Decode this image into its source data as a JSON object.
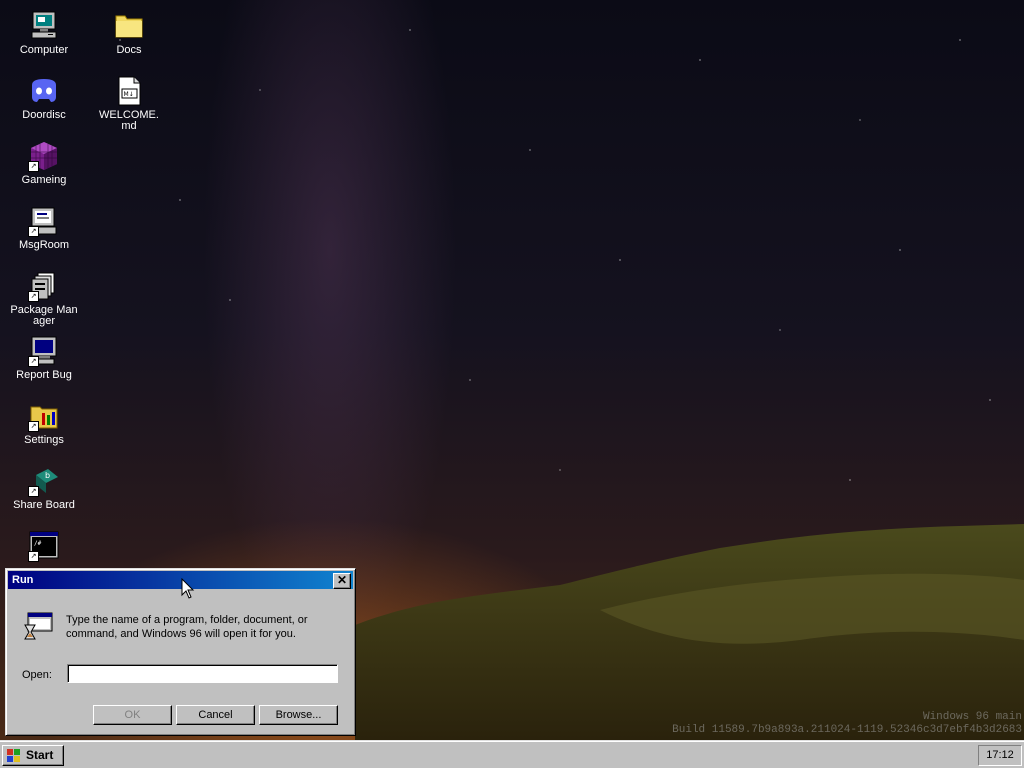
{
  "desktop": {
    "icons": [
      {
        "label": "Computer",
        "icon": "computer-icon",
        "shortcut": false
      },
      {
        "label": "Doordisc",
        "icon": "chat-app-icon",
        "shortcut": false
      },
      {
        "label": "Gameing",
        "icon": "cube-icon",
        "shortcut": true
      },
      {
        "label": "MsgRoom",
        "icon": "message-room-icon",
        "shortcut": true
      },
      {
        "label": "Package Manager",
        "icon": "package-icon",
        "shortcut": true
      },
      {
        "label": "Report Bug",
        "icon": "monitor-icon",
        "shortcut": true
      },
      {
        "label": "Settings",
        "icon": "settings-folder-icon",
        "shortcut": true
      },
      {
        "label": "Share Board",
        "icon": "share-board-icon",
        "shortcut": true
      },
      {
        "label": "",
        "icon": "terminal-icon",
        "shortcut": true
      },
      {
        "label": "Docs",
        "icon": "folder-icon",
        "shortcut": false
      },
      {
        "label": "WELCOME.md",
        "icon": "markdown-file-icon",
        "shortcut": false
      }
    ],
    "watermark": {
      "line1": "Windows 96 main",
      "line2": "Build 11589.7b9a893a.211024-1119.52346c3d7ebf4b3d2683"
    }
  },
  "run_dialog": {
    "title": "Run",
    "close_label": "✕",
    "message": "Type the name of a program, folder, document, or command, and Windows 96 will open it for you.",
    "open_label": "Open:",
    "open_value": "",
    "ok_label": "OK",
    "cancel_label": "Cancel",
    "browse_label": "Browse..."
  },
  "taskbar": {
    "start_label": "Start",
    "clock": "17:12"
  },
  "colors": {
    "titlebar_start": "#000080",
    "titlebar_end": "#1084d0",
    "face": "#c0c0c0"
  }
}
